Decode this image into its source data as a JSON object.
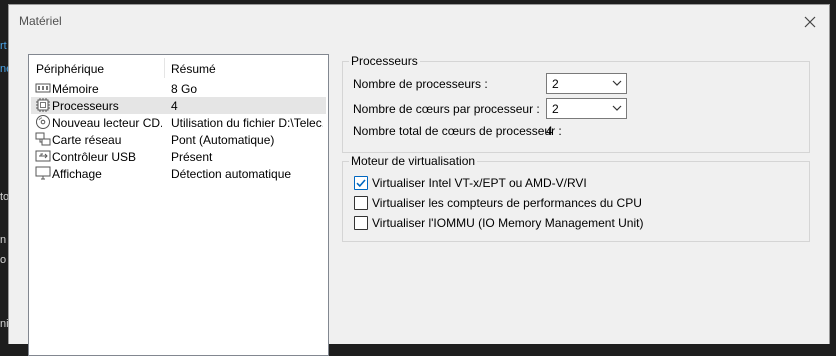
{
  "background": {
    "fragments": [
      {
        "text": "rt",
        "cls": "blue"
      },
      {
        "text": "ne",
        "cls": "blue"
      },
      {
        "text": "to",
        "cls": ""
      },
      {
        "text": "n a",
        "cls": ""
      },
      {
        "text": "o a",
        "cls": ""
      },
      {
        "text": "ni",
        "cls": ""
      }
    ]
  },
  "window": {
    "title": "Matériel"
  },
  "device_list": {
    "headers": {
      "device": "Périphérique",
      "summary": "Résumé"
    },
    "items": [
      {
        "name": "Mémoire",
        "summary": "8 Go",
        "icon": "memory-icon",
        "selected": false
      },
      {
        "name": "Processeurs",
        "summary": "4",
        "icon": "processor-icon",
        "selected": true
      },
      {
        "name": "Nouveau lecteur CD...",
        "summary": "Utilisation du fichier D:\\Telec...",
        "icon": "cd-drive-icon",
        "selected": false
      },
      {
        "name": "Carte réseau",
        "summary": "Pont (Automatique)",
        "icon": "network-adapter-icon",
        "selected": false
      },
      {
        "name": "Contrôleur USB",
        "summary": "Présent",
        "icon": "usb-controller-icon",
        "selected": false
      },
      {
        "name": "Affichage",
        "summary": "Détection automatique",
        "icon": "display-icon",
        "selected": false
      }
    ]
  },
  "processors": {
    "group_label": "Processeurs",
    "num_processors_label": "Nombre de processeurs :",
    "num_processors_value": "2",
    "cores_per_proc_label": "Nombre de cœurs par processeur :",
    "cores_per_proc_value": "2",
    "total_cores_label": "Nombre total de cœurs de processeur :",
    "total_cores_value": "4"
  },
  "virtualization": {
    "group_label": "Moteur de virtualisation",
    "options": [
      {
        "label": "Virtualiser Intel VT-x/EPT ou AMD-V/RVI",
        "checked": true
      },
      {
        "label": "Virtualiser les compteurs de performances du CPU",
        "checked": false
      },
      {
        "label": "Virtualiser l'IOMMU (IO Memory Management Unit)",
        "checked": false
      }
    ]
  },
  "colors": {
    "accent": "#0067c0",
    "selection": "#e5e5e5"
  }
}
